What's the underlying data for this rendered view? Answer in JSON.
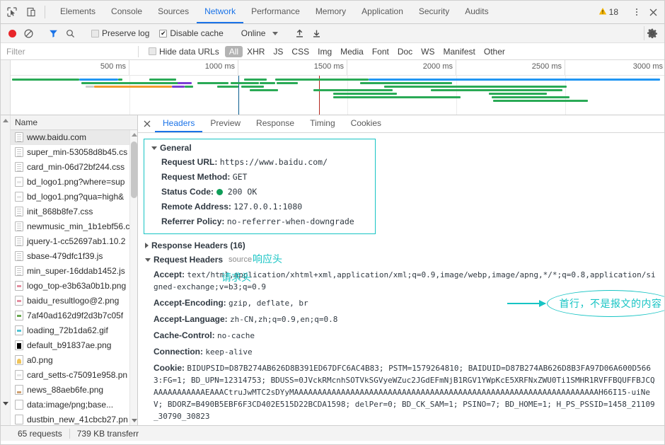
{
  "window": {
    "devtools_tabs": [
      {
        "label": "Elements",
        "active": false
      },
      {
        "label": "Console",
        "active": false
      },
      {
        "label": "Sources",
        "active": false
      },
      {
        "label": "Network",
        "active": true
      },
      {
        "label": "Performance",
        "active": false
      },
      {
        "label": "Memory",
        "active": false
      },
      {
        "label": "Application",
        "active": false
      },
      {
        "label": "Security",
        "active": false
      },
      {
        "label": "Audits",
        "active": false
      }
    ],
    "inspect_icon": "inspect-element-icon",
    "device_icon": "device-toolbar-icon",
    "warning_count": "18",
    "warning_icon": "warning-triangle-icon",
    "more_icon": "kebab-menu-icon",
    "close_icon": "close-icon"
  },
  "toolbar": {
    "record_icon": "record-button-icon",
    "clear_icon": "clear-icon",
    "filter_icon": "filter-funnel-icon",
    "search_icon": "search-icon",
    "preserve_log": {
      "label": "Preserve log",
      "checked": false
    },
    "disable_cache": {
      "label": "Disable cache",
      "checked": true
    },
    "throttle_value": "Online",
    "import_icon": "import-har-icon",
    "export_icon": "export-har-icon",
    "settings_icon": "gear-icon"
  },
  "filterbar": {
    "placeholder": "Filter",
    "value": "",
    "hide_data_urls": {
      "label": "Hide data URLs",
      "checked": false
    },
    "types": [
      {
        "label": "All",
        "active": true
      },
      {
        "label": "XHR",
        "active": false
      },
      {
        "label": "JS",
        "active": false
      },
      {
        "label": "CSS",
        "active": false
      },
      {
        "label": "Img",
        "active": false
      },
      {
        "label": "Media",
        "active": false
      },
      {
        "label": "Font",
        "active": false
      },
      {
        "label": "Doc",
        "active": false
      },
      {
        "label": "WS",
        "active": false
      },
      {
        "label": "Manifest",
        "active": false
      },
      {
        "label": "Other",
        "active": false
      }
    ]
  },
  "overview": {
    "ticks": [
      "500 ms",
      "1000 ms",
      "1500 ms",
      "2000 ms",
      "2500 ms",
      "3000 ms"
    ],
    "dom_content_loaded_color": "#0b5d8f",
    "load_event_color": "#b3261e",
    "bar_color_default": "#2aaa56",
    "bar_color_receiving": "#2196f3",
    "bar_color_waiting": "#f29b2e",
    "bar_color_other": "#7b3fd4"
  },
  "requests": {
    "column_header": "Name",
    "items": [
      {
        "name": "www.baidu.com",
        "icon": "document-file-icon",
        "selected": true
      },
      {
        "name": "super_min-53058d8b45.cs",
        "icon": "document-file-icon",
        "selected": false
      },
      {
        "name": "card_min-06d72bf244.css",
        "icon": "document-file-icon",
        "selected": false
      },
      {
        "name": "bd_logo1.png?where=sup",
        "icon": "image-file-icon",
        "selected": false
      },
      {
        "name": "bd_logo1.png?qua=high&",
        "icon": "image-file-icon",
        "selected": false
      },
      {
        "name": "init_868b8fe7.css",
        "icon": "document-file-icon",
        "selected": false
      },
      {
        "name": "newmusic_min_1b1ebf56.c",
        "icon": "document-file-icon",
        "selected": false
      },
      {
        "name": "jquery-1-cc52697ab1.10.2",
        "icon": "document-file-icon",
        "selected": false
      },
      {
        "name": "sbase-479dfc1f39.js",
        "icon": "document-file-icon",
        "selected": false
      },
      {
        "name": "min_super-16ddab1452.js",
        "icon": "document-file-icon",
        "selected": false
      },
      {
        "name": "logo_top-e3b63a0b1b.png",
        "icon": "image-file-icon",
        "selected": false
      },
      {
        "name": "baidu_resultlogo@2.png",
        "icon": "image-file-icon",
        "selected": false
      },
      {
        "name": "7af40ad162d9f2d3b7c05f",
        "icon": "image-file-icon",
        "selected": false
      },
      {
        "name": "loading_72b1da62.gif",
        "icon": "image-file-icon",
        "selected": false
      },
      {
        "name": "default_b91837ae.png",
        "icon": "image-file-icon",
        "selected": false
      },
      {
        "name": "a0.png",
        "icon": "image-file-icon",
        "selected": false
      },
      {
        "name": "card_setts-c75091e958.pn",
        "icon": "image-file-icon",
        "selected": false
      },
      {
        "name": "news_88aeb6fe.png",
        "icon": "image-file-icon",
        "selected": false
      },
      {
        "name": "data:image/png;base...",
        "icon": "image-file-icon",
        "selected": false
      },
      {
        "name": "dustbin_new_41cbcb27.pn",
        "icon": "image-file-icon",
        "selected": false
      }
    ]
  },
  "details": {
    "tabs": [
      {
        "label": "Headers",
        "active": true
      },
      {
        "label": "Preview",
        "active": false
      },
      {
        "label": "Response",
        "active": false
      },
      {
        "label": "Timing",
        "active": false
      },
      {
        "label": "Cookies",
        "active": false
      }
    ],
    "close_label": "✕",
    "general": {
      "title": "General",
      "rows": [
        {
          "key": "Request URL:",
          "value": "https://www.baidu.com/"
        },
        {
          "key": "Request Method:",
          "value": "GET"
        },
        {
          "key": "Status Code:",
          "value": "200 OK",
          "has_status_dot": true
        },
        {
          "key": "Remote Address:",
          "value": "127.0.0.1:1080"
        },
        {
          "key": "Referrer Policy:",
          "value": "no-referrer-when-downgrade"
        }
      ]
    },
    "response_headers": {
      "title": "Response Headers (16)"
    },
    "request_headers": {
      "title": "Request Headers",
      "view_source": "source"
    },
    "headers": [
      {
        "key": "Accept:",
        "value": "text/html,application/xhtml+xml,application/xml;q=0.9,image/webp,image/apng,*/*;q=0.8,application/signed-exchange;v=b3;q=0.9"
      },
      {
        "key": "Accept-Encoding:",
        "value": "gzip, deflate, br"
      },
      {
        "key": "Accept-Language:",
        "value": "zh-CN,zh;q=0.9,en;q=0.8"
      },
      {
        "key": "Cache-Control:",
        "value": "no-cache"
      },
      {
        "key": "Connection:",
        "value": "keep-alive"
      },
      {
        "key": "Cookie:",
        "value": "BIDUPSID=D87B274AB626D8B391ED67DFC6AC4B83; PSTM=1579264810; BAIDUID=D87B274AB626D8B3FA97D06A600D5663:FG=1; BD_UPN=12314753; BDUSS=0JVckRMcnhSOTVkSGVyeWZuc2JGdEFmNjB1RGV1YWpKcE5XRFNxZWU0Ti1SMHR1RVFFBQUFFBJCQAAAAAAAAAAAEAAACtruJwMTC2sDYyMAAAAAAAAAAAAAAAAAAAAAAAAAAAAAAAAAAAAAAAAAAAAAAAAAAAAAAAAAAAAAAAAAH66I15-uiNeV; BDORZ=B490B5EBF6F3CD402E515D22BCDA1598; delPer=0; BD_CK_SAM=1; PSINO=7; BD_HOME=1; H_PS_PSSID=1458_21109_30790_30823"
      }
    ]
  },
  "annotations": {
    "first_line": "首行，不是报文的内容",
    "response_headers": "响应头",
    "request_headers": "请求头"
  },
  "statusbar": {
    "requests": "65 requests",
    "transferred": "739 KB transferr"
  },
  "colors": {
    "accent": "#1a73e8",
    "annotation": "#17c4c4",
    "status_ok": "#0f9d58",
    "record": "#e8262a"
  }
}
